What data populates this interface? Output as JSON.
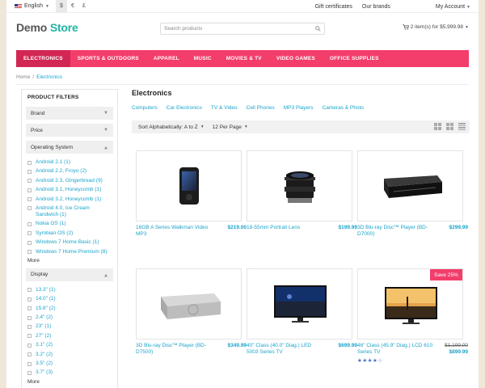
{
  "topbar": {
    "language": "English",
    "currencies": [
      "$",
      "€",
      "£"
    ],
    "links": [
      "Gift certificates",
      "Our brands"
    ],
    "account": "My Account"
  },
  "header": {
    "logo_part1": "Demo",
    "logo_part2": "Store",
    "search_placeholder": "Search products",
    "cart_text": "2 item(s) for $5,999.98"
  },
  "nav": [
    "ELECTRONICS",
    "SPORTS & OUTDOORS",
    "APPAREL",
    "MUSIC",
    "MOVIES & TV",
    "VIDEO GAMES",
    "OFFICE SUPPLIES"
  ],
  "breadcrumb": {
    "home": "Home",
    "sep": "/",
    "current": "Electronics"
  },
  "sidebar": {
    "title": "PRODUCT FILTERS",
    "brand": "Brand",
    "price": "Price",
    "os": "Operating System",
    "os_options": [
      "Android 2.1  (1)",
      "Android 2.2, Froyo  (2)",
      "Android 2.3, Gingerbread  (9)",
      "Android 3.1, Honeycomb  (1)",
      "Android 3.2, Honeycomb  (1)",
      "Android 4.0, Ice Cream Sandwich  (1)",
      "Nokia OS  (1)",
      "Symbian OS  (2)",
      "Windows 7 Home Basic  (1)",
      "Windows 7 Home Premium  (8)"
    ],
    "more": "More",
    "display": "Display",
    "display_options": [
      "13.3\"  (1)",
      "14.0\"  (1)",
      "15.6\"  (2)",
      "2.4\"  (2)",
      "23\"  (1)",
      "27\"  (2)",
      "3.1\"  (2)",
      "3.2\"  (2)",
      "3.5\"  (2)",
      "3.7\"  (3)"
    ],
    "more2": "More"
  },
  "main": {
    "title": "Electronics",
    "subcategories": [
      "Computers",
      "Car Electronics",
      "TV & Video",
      "Cell Phones",
      "MP3 Players",
      "Cameras & Photo"
    ],
    "sort_label": "Sort Alphabetically: A to Z",
    "per_page_label": "12 Per Page"
  },
  "products": [
    {
      "name": "16GB A Series Walkman Video MP3",
      "price": "$219.00"
    },
    {
      "name": "18-55mm Portrait Lens",
      "price": "$199.99"
    },
    {
      "name": "3D Blu-ray Disc™ Player (BD-D7000)",
      "price": "$299.99"
    },
    {
      "name": "3D Blu-ray Disc™ Player (BD-D7500)",
      "price": "$349.99"
    },
    {
      "name": "40\" Class (40.0\" Diag.) LED 5003 Series TV",
      "price": "$699.99"
    },
    {
      "name": "46\" Class (45.9\" Diag.) LCD 610 Series TV",
      "price": "$899.99",
      "old_price": "$1,199.00",
      "badge": "Save 25%",
      "rating": 4
    }
  ],
  "colors": {
    "accent": "#f33d6a",
    "link": "#1aa4c9",
    "logo": "#21b4a6"
  }
}
